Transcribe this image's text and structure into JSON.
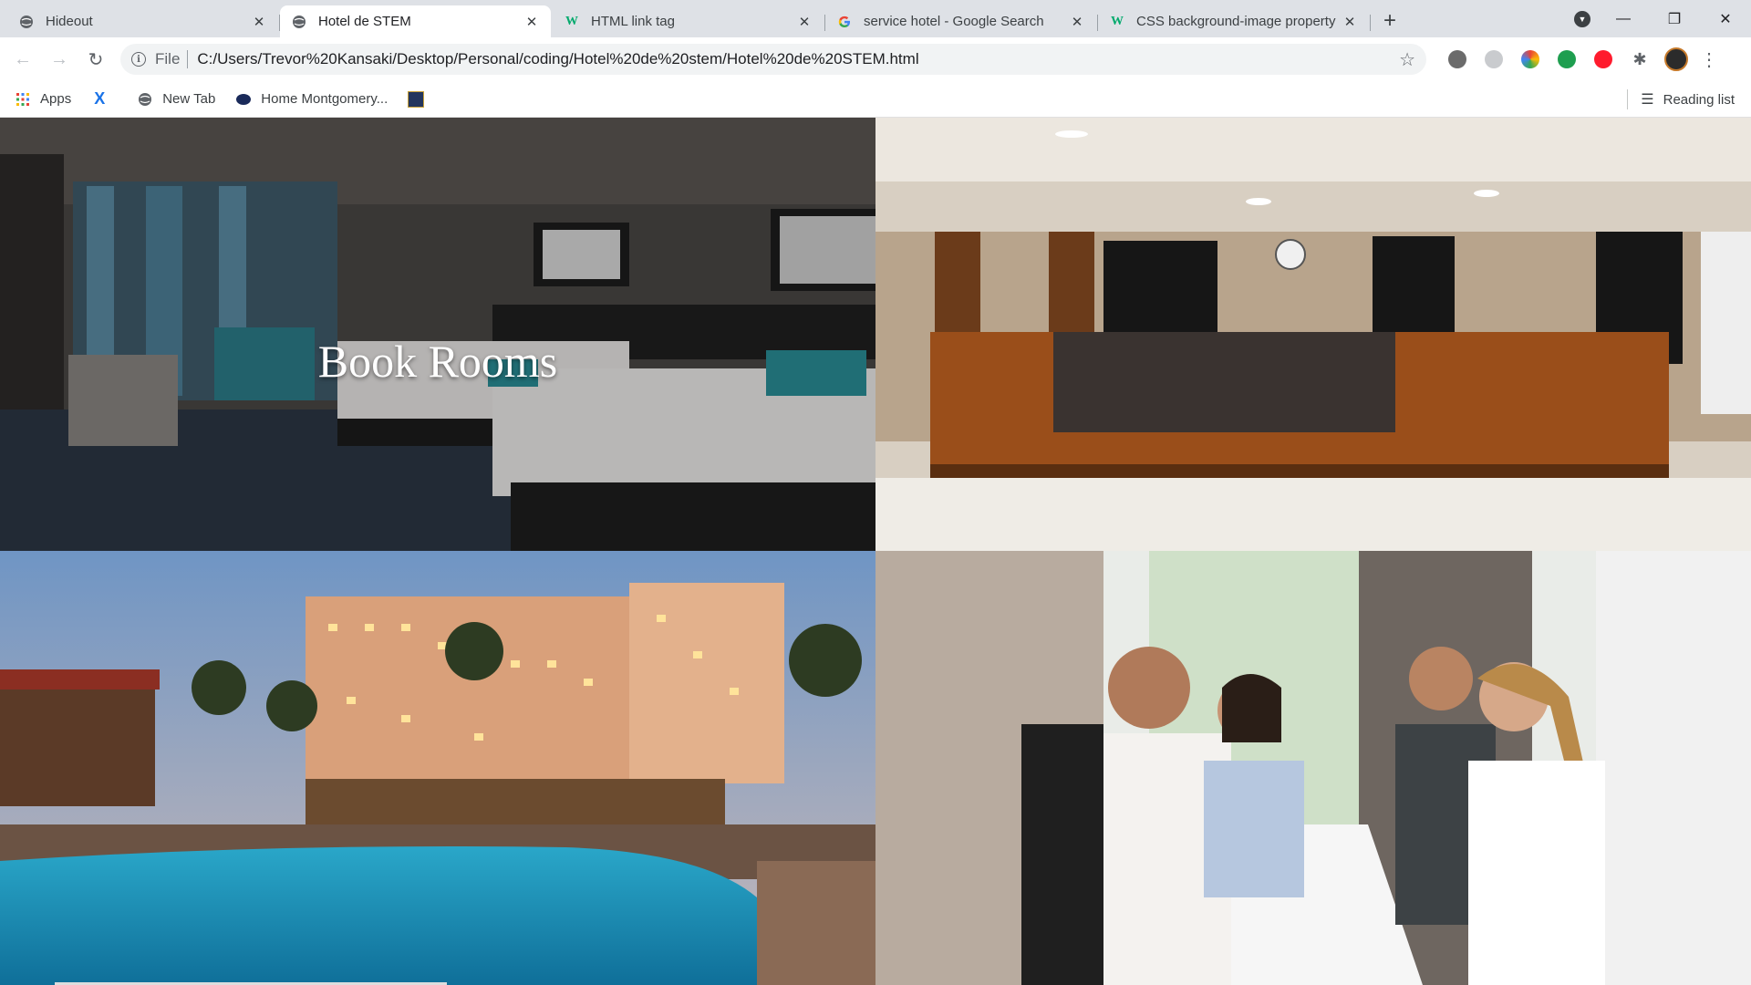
{
  "browser": {
    "tabs": [
      {
        "title": "Hideout",
        "active": false,
        "favicon": "globe-icon"
      },
      {
        "title": "Hotel de STEM",
        "active": true,
        "favicon": "globe-icon"
      },
      {
        "title": "HTML link tag",
        "active": false,
        "favicon": "w3-icon"
      },
      {
        "title": "service hotel - Google Search",
        "active": false,
        "favicon": "google-icon"
      },
      {
        "title": "CSS background-image property",
        "active": false,
        "favicon": "w3-icon"
      }
    ],
    "omnibox": {
      "scheme_label": "File",
      "url": "C:/Users/Trevor%20Kansaki/Desktop/Personal/coding/Hotel%20de%20stem/Hotel%20de%20STEM.html"
    }
  },
  "bookmarks": {
    "items": [
      {
        "label": "Apps",
        "icon": "apps-grid-icon"
      },
      {
        "label": "",
        "icon": "x-logo-icon"
      },
      {
        "label": "New Tab",
        "icon": "globe-icon"
      },
      {
        "label": "Home Montgomery...",
        "icon": "site-logo-icon"
      },
      {
        "label": "",
        "icon": "site-badge-icon"
      }
    ],
    "reading_list": "Reading list"
  },
  "page": {
    "panels": [
      {
        "title": "Book Rooms",
        "image": "hotel-room-photo"
      },
      {
        "title": "",
        "image": "reception-desk-photo"
      },
      {
        "title": "",
        "image": "hotel-pool-photo"
      },
      {
        "title": "",
        "image": "check-in-photo"
      }
    ]
  },
  "colors": {
    "tabstrip": "#dee1e6",
    "omnibox": "#f1f3f4",
    "accent_w3": "#04aa6d"
  }
}
